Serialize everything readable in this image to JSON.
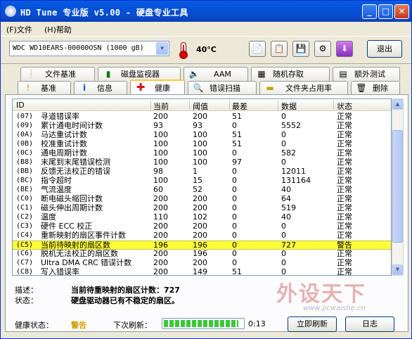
{
  "window": {
    "title": "HD Tune 专业版 v5.00 - 硬盘专业工具",
    "min_label": "_",
    "max_label": "□",
    "close_label": "✕"
  },
  "menu": {
    "file": "(F)文件",
    "help": "(H)帮助"
  },
  "toolbar": {
    "drive": "WDC WD10EARS-00000OSN (1000 gB)",
    "temperature": "40°C",
    "exit_label": "退出",
    "icons": [
      "copy-text-icon",
      "copy-screenshot-icon",
      "save-icon",
      "options-icon",
      "download-icon"
    ]
  },
  "tabs_top": [
    {
      "label": "文件基准",
      "icon": "file-benchmark-icon"
    },
    {
      "label": "磁盘监视器",
      "icon": "disk-monitor-icon"
    },
    {
      "label": "AAM",
      "icon": "speaker-icon"
    },
    {
      "label": "随机存取",
      "icon": "random-access-icon"
    },
    {
      "label": "额外测试",
      "icon": "extra-tests-icon"
    }
  ],
  "tabs_bottom": [
    {
      "label": "基准",
      "icon": "benchmark-icon"
    },
    {
      "label": "信息",
      "icon": "info-icon"
    },
    {
      "label": "健康",
      "icon": "health-cross-icon"
    },
    {
      "label": "错误扫描",
      "icon": "error-scan-icon"
    },
    {
      "label": "文件夹占用率",
      "icon": "folder-usage-icon"
    },
    {
      "label": "删除",
      "icon": "erase-icon"
    }
  ],
  "columns": [
    "ID",
    "当前",
    "阈值",
    "最差",
    "数据",
    "状态"
  ],
  "rows": [
    {
      "id": "(07)",
      "name": "寻道错误率",
      "current": "200",
      "threshold": "200",
      "worst": "51",
      "data": "0",
      "status": "正常"
    },
    {
      "id": "(09)",
      "name": "累计通电时间计数",
      "current": "93",
      "threshold": "93",
      "worst": "0",
      "data": "5552",
      "status": "正常"
    },
    {
      "id": "(0A)",
      "name": "马达重试计数",
      "current": "100",
      "threshold": "100",
      "worst": "51",
      "data": "0",
      "status": "正常"
    },
    {
      "id": "(0B)",
      "name": "校准重试计数",
      "current": "100",
      "threshold": "100",
      "worst": "51",
      "data": "0",
      "status": "正常"
    },
    {
      "id": "(0C)",
      "name": "通电周期计数",
      "current": "100",
      "threshold": "100",
      "worst": "0",
      "data": "582",
      "status": "正常"
    },
    {
      "id": "(B8)",
      "name": "末尾到末尾错误检测",
      "current": "100",
      "threshold": "100",
      "worst": "97",
      "data": "0",
      "status": "正常"
    },
    {
      "id": "(BB)",
      "name": "反馈无法校正的错误",
      "current": "98",
      "threshold": "1",
      "worst": "0",
      "data": "12011",
      "status": "正常"
    },
    {
      "id": "(BC)",
      "name": "指令超时",
      "current": "100",
      "threshold": "15",
      "worst": "0",
      "data": "131164",
      "status": "正常"
    },
    {
      "id": "(BE)",
      "name": "气流温度",
      "current": "60",
      "threshold": "52",
      "worst": "0",
      "data": "40",
      "status": "正常"
    },
    {
      "id": "(C0)",
      "name": "断电磁头缩回计数",
      "current": "200",
      "threshold": "200",
      "worst": "0",
      "data": "64",
      "status": "正常"
    },
    {
      "id": "(C1)",
      "name": "磁头伸出周期计数",
      "current": "200",
      "threshold": "200",
      "worst": "0",
      "data": "519",
      "status": "正常"
    },
    {
      "id": "(C2)",
      "name": "温度",
      "current": "110",
      "threshold": "102",
      "worst": "0",
      "data": "40",
      "status": "正常"
    },
    {
      "id": "(C3)",
      "name": "硬件 ECC 校正",
      "current": "200",
      "threshold": "200",
      "worst": "0",
      "data": "0",
      "status": "正常"
    },
    {
      "id": "(C4)",
      "name": "重新映射的扇区事件计数",
      "current": "200",
      "threshold": "200",
      "worst": "0",
      "data": "0",
      "status": "正常"
    },
    {
      "id": "(C5)",
      "name": "当前待映射的扇区数",
      "current": "196",
      "threshold": "196",
      "worst": "0",
      "data": "727",
      "status": "警告",
      "highlight": true
    },
    {
      "id": "(C6)",
      "name": "脱机无法校正的扇区数",
      "current": "200",
      "threshold": "196",
      "worst": "0",
      "data": "0",
      "status": "正常"
    },
    {
      "id": "(C7)",
      "name": "Ultra DMA CRC 错误计数",
      "current": "200",
      "threshold": "200",
      "worst": "0",
      "data": "0",
      "status": "正常"
    },
    {
      "id": "(C8)",
      "name": "写入错误率",
      "current": "200",
      "threshold": "149",
      "worst": "51",
      "data": "0",
      "status": "正常"
    }
  ],
  "details": {
    "desc_label": "描述：",
    "desc_value": "当前待重映射的扇区计数：727",
    "state_label": "状态：",
    "state_value": "硬盘驱动器已有不稳定的扇区。"
  },
  "footer": {
    "health_label": "健康状态：",
    "health_value": "警告",
    "next_refresh_label": "下次刷新：",
    "progress": 0.95,
    "timer": "0:13",
    "refresh_label": "立即刷新",
    "log_label": "日志"
  },
  "watermark": {
    "brand": "外设天下",
    "url": "www.pcwaishe.cn"
  },
  "colors": {
    "highlight": "#ffff33",
    "warning": "#d4a000",
    "title_bar": "#0a5bdf"
  }
}
